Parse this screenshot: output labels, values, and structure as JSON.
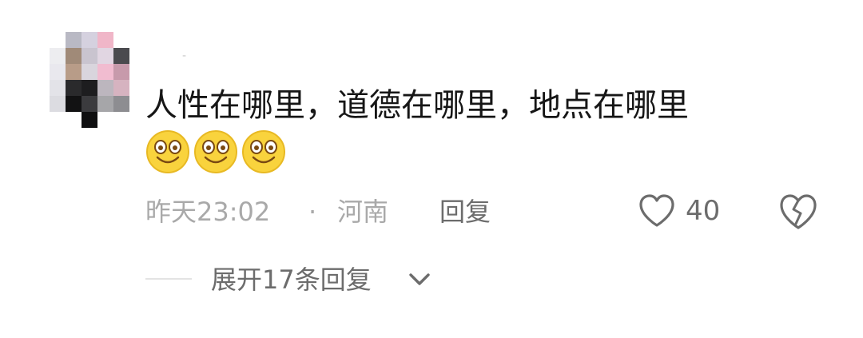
{
  "comment": {
    "username": "-",
    "text": "人性在哪里，道德在哪里，地点在哪里",
    "emojis": [
      "smile-emoji",
      "smile-emoji",
      "smile-emoji"
    ],
    "time": "昨天23:02",
    "separator": "·",
    "location": "河南",
    "reply_label": "回复",
    "like_count": "40",
    "expand_label": "展开17条回复"
  },
  "colors": {
    "text": "#161616",
    "meta": "#a9a9a9",
    "action": "#6c6c6c",
    "emoji_face": "#f9d33d"
  },
  "icons": {
    "like": "heart-outline-icon",
    "dislike": "broken-heart-icon",
    "expand": "chevron-down-icon"
  }
}
